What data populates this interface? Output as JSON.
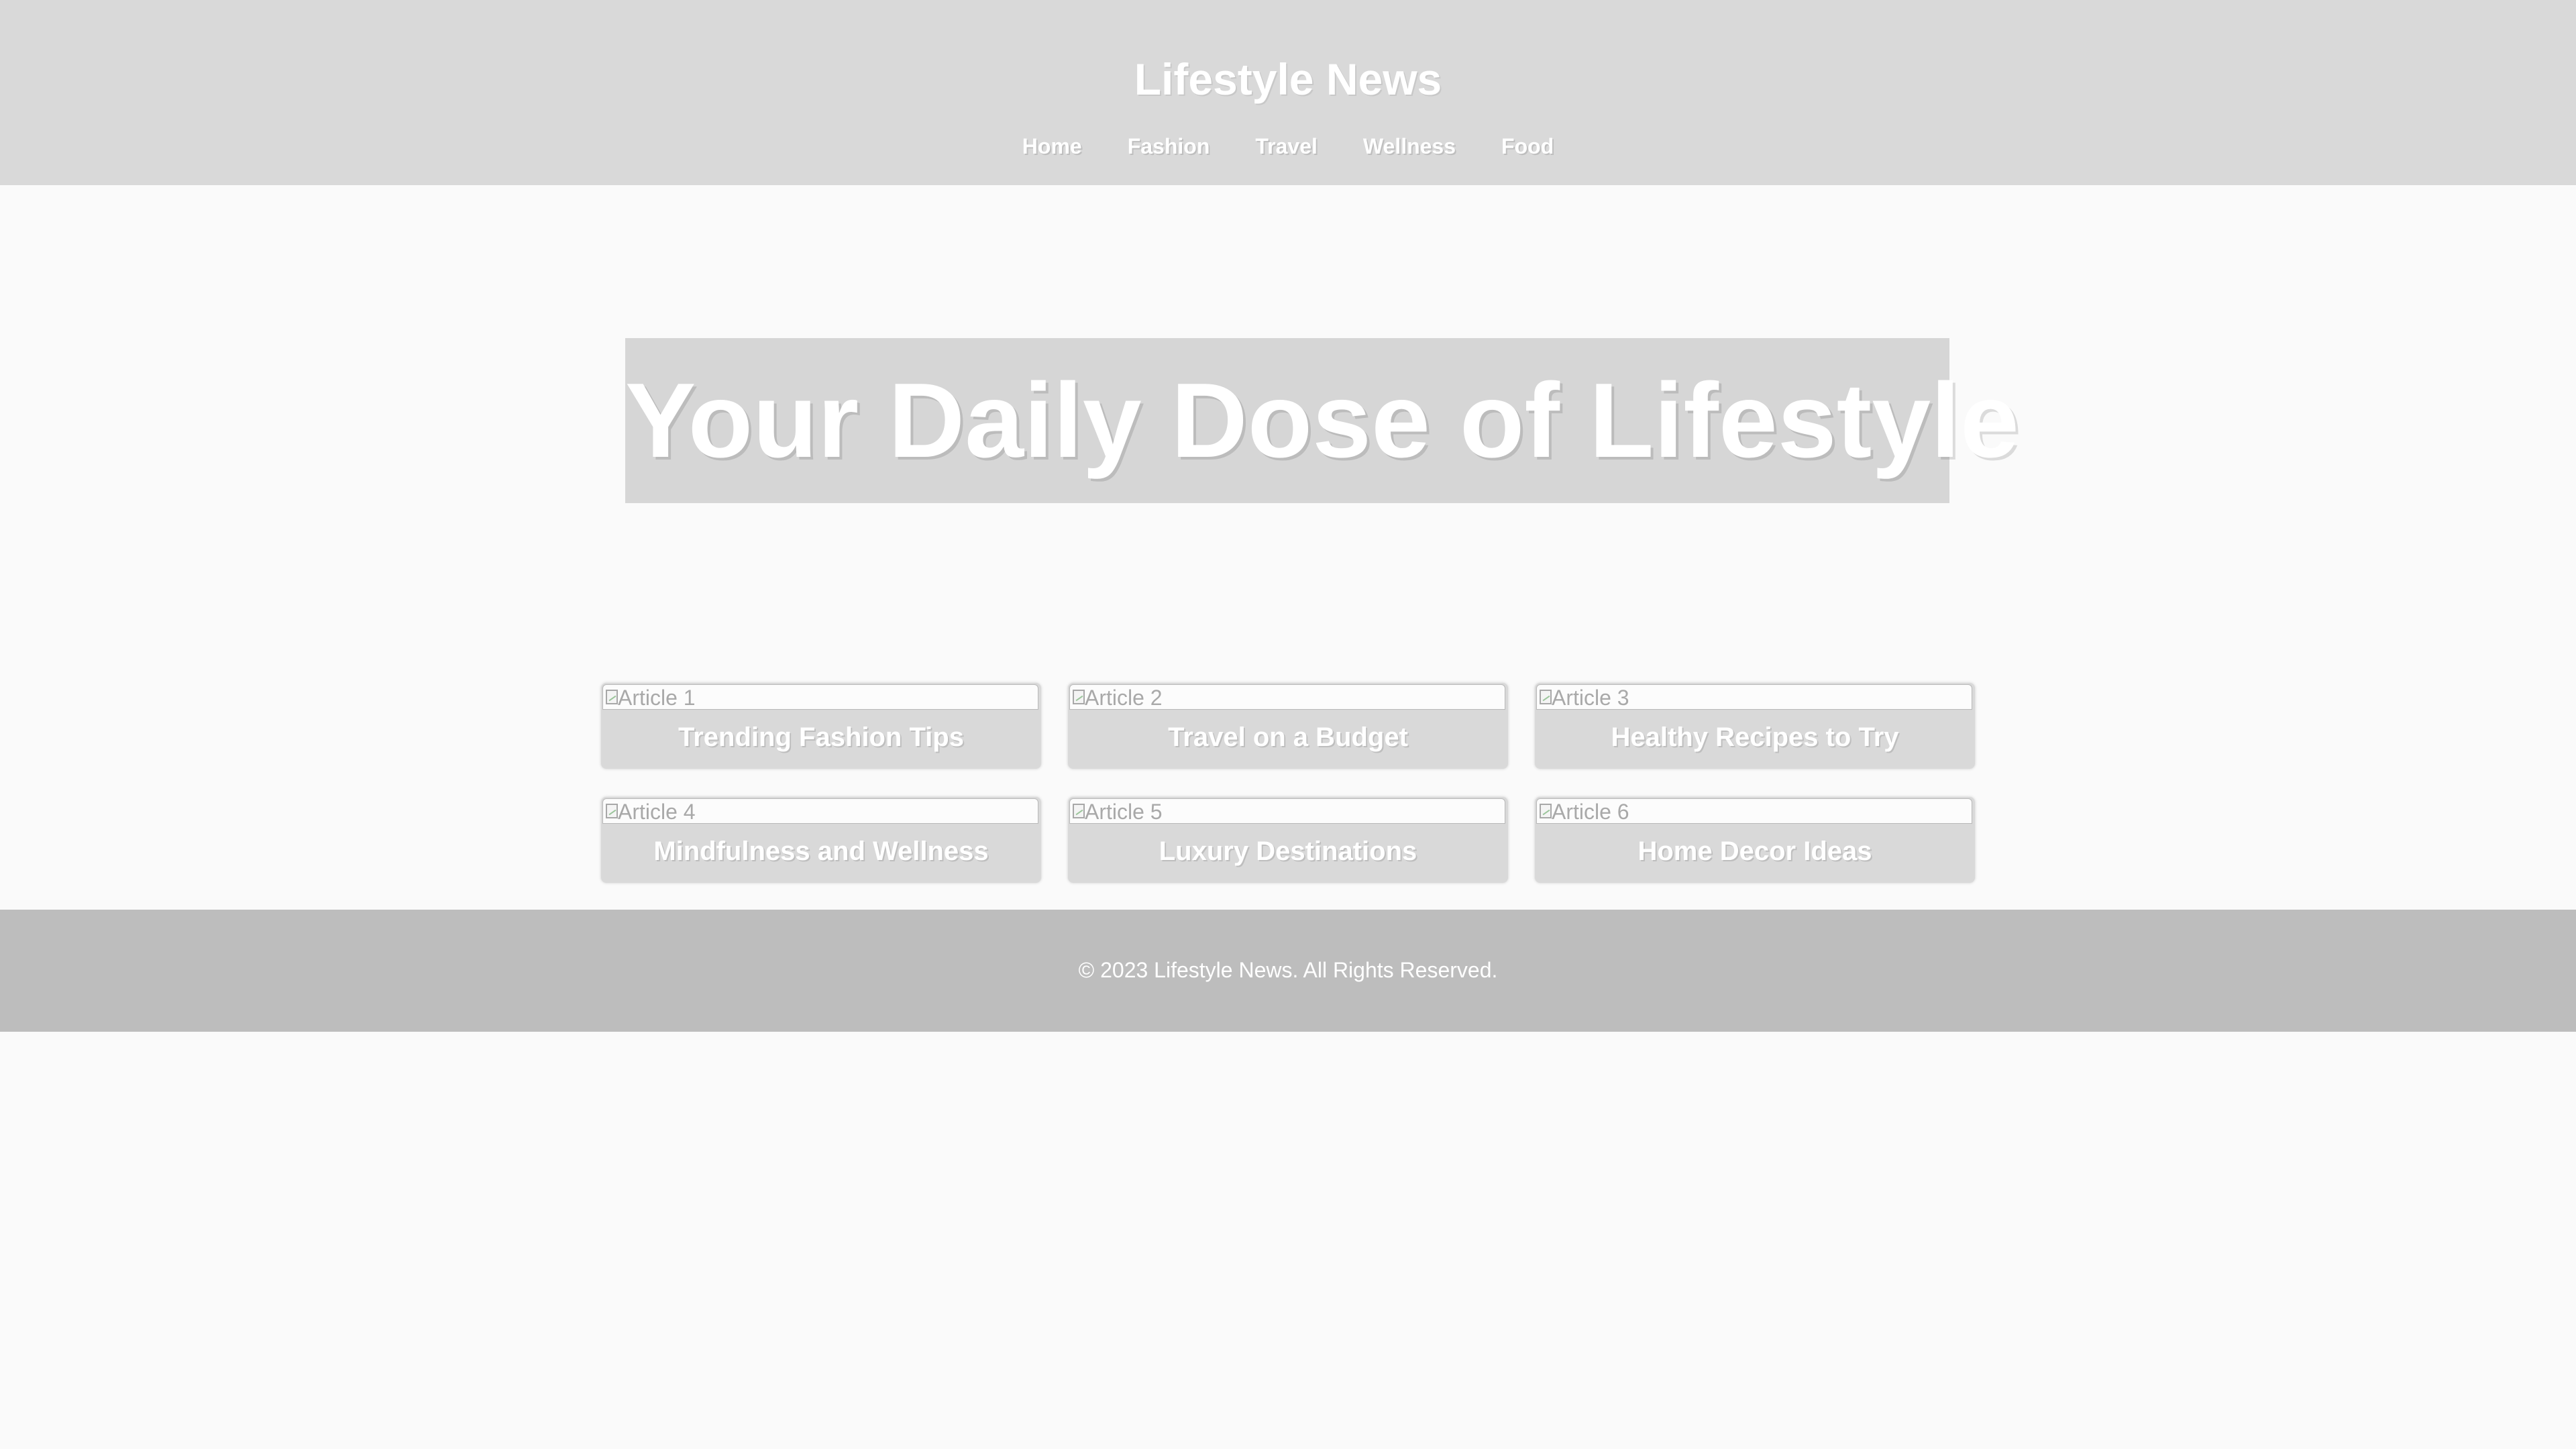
{
  "header": {
    "title": "Lifestyle News",
    "nav": [
      "Home",
      "Fashion",
      "Travel",
      "Wellness",
      "Food"
    ]
  },
  "hero": {
    "title": "Your Daily Dose of Lifestyle"
  },
  "articles": [
    {
      "image_alt": "Article 1",
      "title": "Trending Fashion Tips"
    },
    {
      "image_alt": "Article 2",
      "title": "Travel on a Budget"
    },
    {
      "image_alt": "Article 3",
      "title": "Healthy Recipes to Try"
    },
    {
      "image_alt": "Article 4",
      "title": "Mindfulness and Wellness"
    },
    {
      "image_alt": "Article 5",
      "title": "Luxury Destinations"
    },
    {
      "image_alt": "Article 6",
      "title": "Home Decor Ideas"
    }
  ],
  "footer": {
    "text": "© 2023 Lifestyle News. All Rights Reserved."
  },
  "colors": {
    "header_bg": "#d9d9d9",
    "hero_bg": "#d6d6d6",
    "card_bg": "#d9d9d9",
    "footer_bg": "#bdbdbd",
    "page_bg": "#fafafa",
    "text": "#ffffff"
  },
  "icons": {
    "article_image": "broken-image-icon"
  }
}
